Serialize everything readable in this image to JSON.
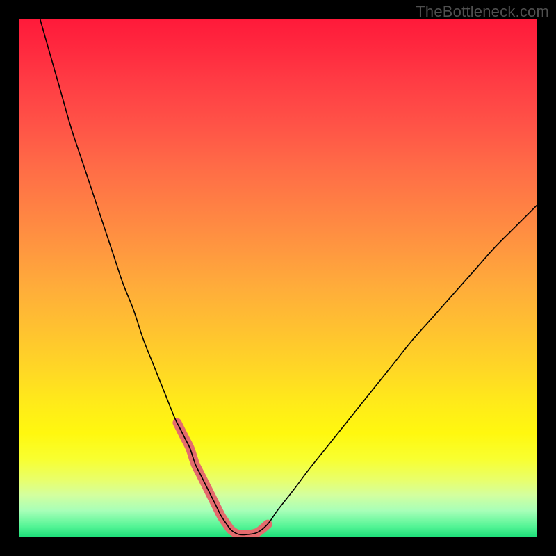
{
  "watermark": "TheBottleneck.com",
  "chart_data": {
    "type": "line",
    "title": "",
    "xlabel": "",
    "ylabel": "",
    "xlim": [
      0,
      100
    ],
    "ylim": [
      0,
      100
    ],
    "grid": false,
    "series": [
      {
        "name": "bottleneck-curve",
        "x": [
          4,
          6,
          8,
          10,
          12,
          14,
          16,
          18,
          20,
          22,
          24,
          26,
          28,
          30,
          31,
          32,
          33,
          34,
          35,
          36,
          37,
          38,
          39,
          40,
          41,
          42.5,
          44,
          46,
          48,
          50,
          53,
          56,
          60,
          64,
          68,
          72,
          76,
          80,
          84,
          88,
          92,
          96,
          100
        ],
        "y": [
          100,
          93,
          86,
          79,
          73,
          67,
          61,
          55,
          49,
          44,
          38,
          33,
          28,
          23,
          21,
          19,
          17,
          14,
          12,
          10,
          8,
          6,
          4,
          2.5,
          1.2,
          0.4,
          0.4,
          0.8,
          2.4,
          5.2,
          9.0,
          13.0,
          18.0,
          23.0,
          28.0,
          33.0,
          38.0,
          42.5,
          47.0,
          51.5,
          56.0,
          60.0,
          64.0
        ]
      }
    ],
    "highlight": {
      "name": "optimal-zone",
      "x_range": [
        30.5,
        48.0
      ],
      "desc": "thick salmon band marking the optimal/minimum region"
    },
    "colors": {
      "curve": "#000000",
      "highlight": "#e46b6d",
      "gradient_top": "#ff1a3a",
      "gradient_mid": "#fff80f",
      "gradient_bottom": "#1fdf7a",
      "background": "#000000",
      "watermark": "#505050"
    }
  }
}
